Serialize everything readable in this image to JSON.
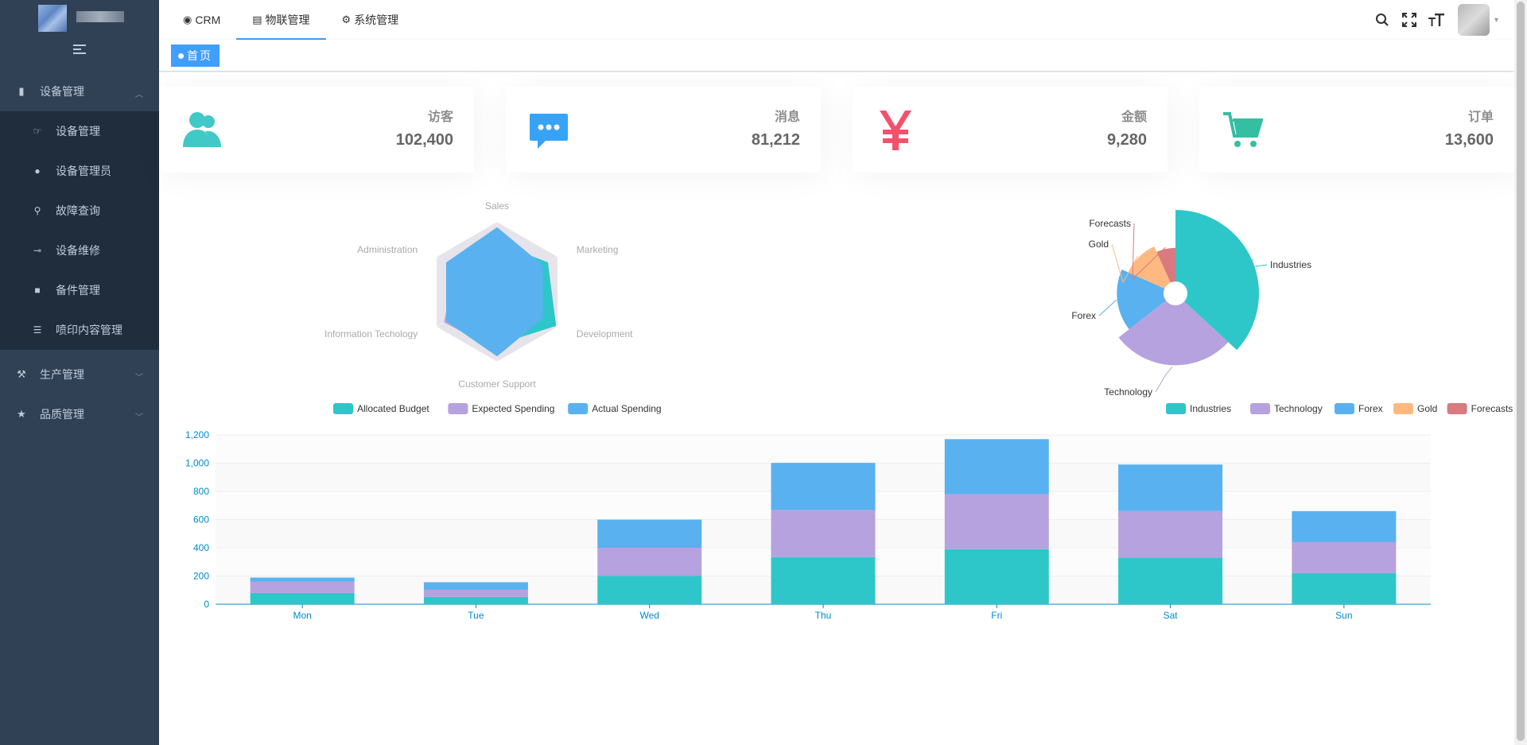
{
  "sidebar": {
    "groups": [
      {
        "label": "设备管理",
        "icon": "book-icon",
        "expanded": true,
        "items": [
          {
            "label": "设备管理",
            "icon": "hand-icon"
          },
          {
            "label": "设备管理员",
            "icon": "user-icon"
          },
          {
            "label": "故障查询",
            "icon": "search-icon"
          },
          {
            "label": "设备维修",
            "icon": "wrench-icon"
          },
          {
            "label": "备件管理",
            "icon": "box-icon"
          },
          {
            "label": "喷印内容管理",
            "icon": "sliders-icon"
          }
        ]
      },
      {
        "label": "生产管理",
        "icon": "production-icon",
        "expanded": false
      },
      {
        "label": "品质管理",
        "icon": "star-icon",
        "expanded": false
      }
    ]
  },
  "topnav": {
    "tabs": [
      {
        "label": "CRM",
        "icon": "github-icon"
      },
      {
        "label": "物联管理",
        "icon": "document-icon",
        "active": true
      },
      {
        "label": "系统管理",
        "icon": "gear-icon"
      }
    ]
  },
  "tagsview": {
    "home": "首页"
  },
  "cards": [
    {
      "title": "访客",
      "value": "102,400",
      "icon": "peoples-icon",
      "color": "#40c9c6"
    },
    {
      "title": "消息",
      "value": "81,212",
      "icon": "message-icon",
      "color": "#36a3f7"
    },
    {
      "title": "金额",
      "value": "9,280",
      "icon": "money-icon",
      "color": "#f4516c"
    },
    {
      "title": "订单",
      "value": "13,600",
      "icon": "shopping-icon",
      "color": "#34bfa3"
    }
  ],
  "chart_data": [
    {
      "type": "radar",
      "indicators": [
        "Sales",
        "Marketing",
        "Development",
        "Customer Support",
        "Information Techology",
        "Administration"
      ],
      "series": [
        {
          "name": "Allocated Budget",
          "values": [
            0.42,
            0.5,
            0.58,
            0.45,
            0.38,
            0.5
          ],
          "color": "#2ec7c9"
        },
        {
          "name": "Expected Spending",
          "values": [
            0.44,
            0.4,
            0.44,
            0.5,
            0.52,
            0.42
          ],
          "color": "#b6a2de"
        },
        {
          "name": "Actual Spending",
          "values": [
            0.55,
            0.45,
            0.45,
            0.55,
            0.5,
            0.5
          ],
          "color": "#5ab1ef"
        }
      ],
      "legend_position": "bottom"
    },
    {
      "type": "pie",
      "rose": true,
      "slices": [
        {
          "name": "Industries",
          "value": 320,
          "color": "#2ec7c9"
        },
        {
          "name": "Technology",
          "value": 240,
          "color": "#b6a2de"
        },
        {
          "name": "Forex",
          "value": 149,
          "color": "#5ab1ef"
        },
        {
          "name": "Gold",
          "value": 100,
          "color": "#ffb980"
        },
        {
          "name": "Forecasts",
          "value": 59,
          "color": "#d87a80"
        }
      ],
      "legend_position": "bottom"
    },
    {
      "type": "bar",
      "stacked": true,
      "categories": [
        "Mon",
        "Tue",
        "Wed",
        "Thu",
        "Fri",
        "Sat",
        "Sun"
      ],
      "series": [
        {
          "values": [
            79,
            52,
            200,
            334,
            390,
            330,
            220
          ],
          "color": "#2ec7c9"
        },
        {
          "values": [
            80,
            52,
            200,
            334,
            390,
            330,
            220
          ],
          "color": "#b6a2de"
        },
        {
          "values": [
            30,
            52,
            200,
            334,
            390,
            330,
            220
          ],
          "color": "#5ab1ef"
        }
      ],
      "yticks": [
        "0",
        "200",
        "400",
        "600",
        "800",
        "1,000",
        "1,200"
      ],
      "ylim": [
        0,
        1200
      ],
      "grid": true
    }
  ]
}
